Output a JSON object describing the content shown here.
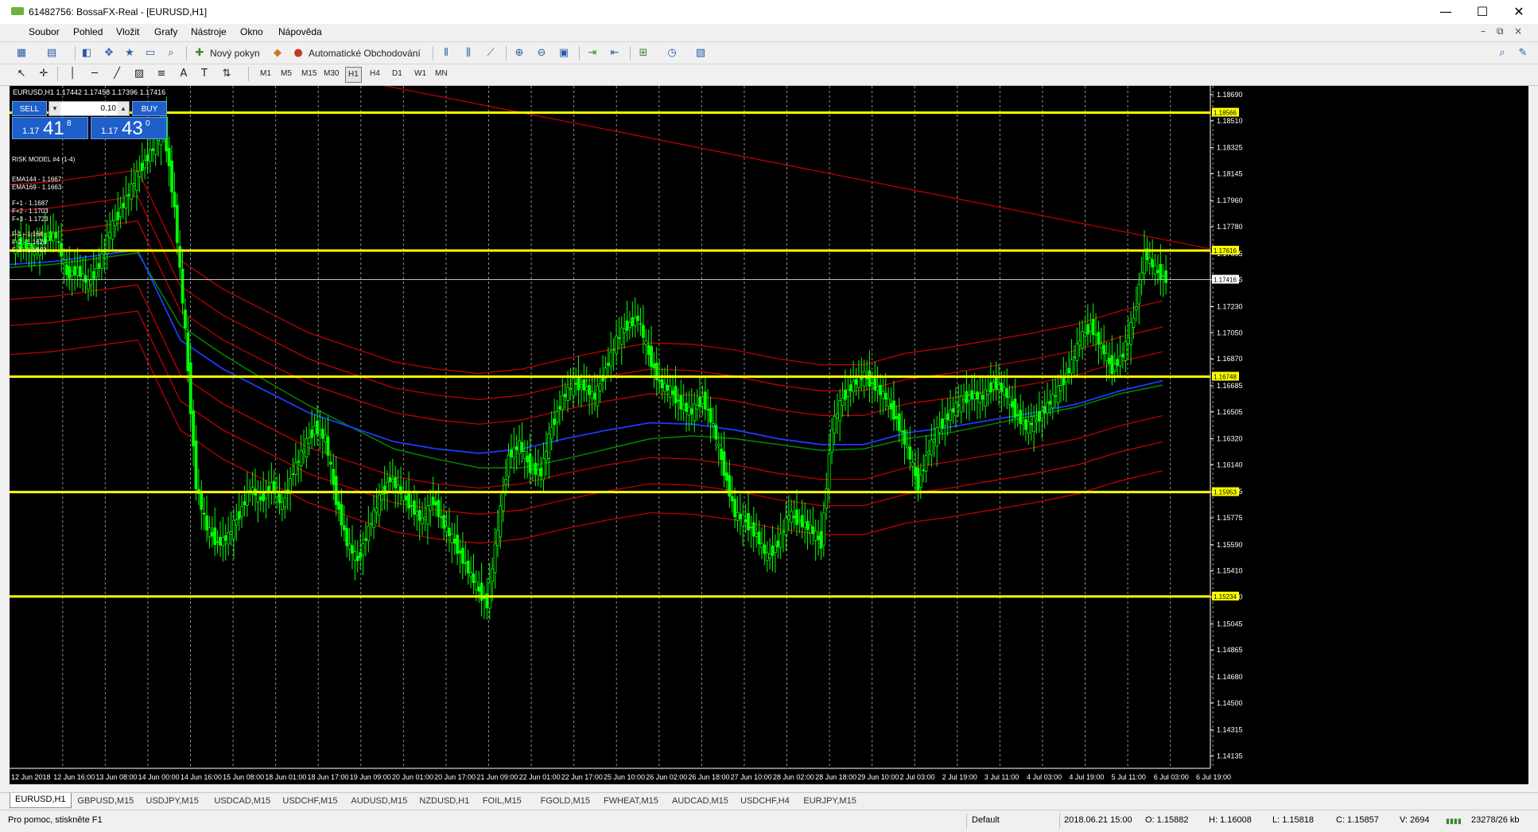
{
  "window": {
    "title": "61482756: BossaFX-Real - [EURUSD,H1]",
    "minimize": "—",
    "maximize": "☐",
    "close": "✕"
  },
  "menu": [
    "Soubor",
    "Pohled",
    "Vložit",
    "Grafy",
    "Nástroje",
    "Okno",
    "Nápověda"
  ],
  "toolbar": {
    "new_order": "Nový pokyn",
    "auto_trading": "Automatické Obchodování"
  },
  "timeframes": [
    "M1",
    "M5",
    "M15",
    "M30",
    "H1",
    "H4",
    "D1",
    "W1",
    "MN"
  ],
  "active_timeframe": "H1",
  "chart": {
    "header": "EURUSD,H1  1.17442 1.17458 1.17396 1.17416",
    "one_click": {
      "sell_label": "SELL",
      "buy_label": "BUY",
      "lot": "0.10",
      "sell_prefix": "1.17",
      "sell_big": "41",
      "sell_sup": "8",
      "buy_prefix": "1.17",
      "buy_big": "43",
      "buy_sup": "0"
    },
    "indicators": {
      "risk_model": "RISK MODEL #4 (1-4)",
      "ema144": "EMA144 - 1.1667",
      "ema169": "EMA169 - 1.1663",
      "fplus1": "F+1 - 1.1687",
      "fplus2": "F+2 - 1.1703",
      "fplus3": "F+3 - 1.1723",
      "fminus1": "F-1 - 1.164",
      "fminus2": "F-2 - 1.1623",
      "fminus3": "F-3 - 1.1603"
    },
    "colors": {
      "background": "#000000",
      "candle": "#00ff00",
      "level_line": "#ffff00",
      "envelope": "#cc0000",
      "ema144": "#1a3cff",
      "ema169": "#008800",
      "grid": "#ffffff"
    }
  },
  "chart_data": {
    "type": "candlestick",
    "symbol": "EURUSD",
    "timeframe": "H1",
    "y_ticks": [
      "1.18690",
      "1.18510",
      "1.18325",
      "1.18145",
      "1.17960",
      "1.17780",
      "1.17595",
      "1.17415",
      "1.17230",
      "1.17050",
      "1.16870",
      "1.16685",
      "1.16505",
      "1.16320",
      "1.16140",
      "1.15955",
      "1.15775",
      "1.15590",
      "1.15410",
      "1.15230",
      "1.15045",
      "1.14865",
      "1.14680",
      "1.14500",
      "1.14315",
      "1.14135"
    ],
    "x_ticks": [
      "12 Jun 2018",
      "12 Jun 16:00",
      "13 Jun 08:00",
      "14 Jun 00:00",
      "14 Jun 16:00",
      "15 Jun 08:00",
      "18 Jun 01:00",
      "18 Jun 17:00",
      "19 Jun 09:00",
      "20 Jun 01:00",
      "20 Jun 17:00",
      "21 Jun 09:00",
      "22 Jun 01:00",
      "22 Jun 17:00",
      "25 Jun 10:00",
      "26 Jun 02:00",
      "26 Jun 18:00",
      "27 Jun 10:00",
      "28 Jun 02:00",
      "28 Jun 18:00",
      "29 Jun 10:00",
      "2 Jul 03:00",
      "2 Jul 19:00",
      "3 Jul 11:00",
      "4 Jul 03:00",
      "4 Jul 19:00",
      "5 Jul 11:00",
      "6 Jul 03:00",
      "6 Jul 19:00"
    ],
    "y_range": [
      1.1405,
      1.1875
    ],
    "horizontal_levels": [
      {
        "value": 1.18566,
        "label": "1.18566"
      },
      {
        "value": 1.17616,
        "label": "1.17616"
      },
      {
        "value": 1.16748,
        "label": "1.16748"
      },
      {
        "value": 1.15953,
        "label": "1.15953"
      },
      {
        "value": 1.15234,
        "label": "1.15234"
      }
    ],
    "current_price": {
      "value": 1.17416,
      "label": "1.17416"
    },
    "closes": [
      1.1765,
      1.1762,
      1.177,
      1.1772,
      1.1745,
      1.1748,
      1.1738,
      1.1752,
      1.1775,
      1.179,
      1.1805,
      1.182,
      1.1832,
      1.1848,
      1.179,
      1.1705,
      1.16,
      1.157,
      1.156,
      1.1565,
      1.158,
      1.1598,
      1.159,
      1.16,
      1.1585,
      1.161,
      1.1625,
      1.164,
      1.1632,
      1.159,
      1.156,
      1.1548,
      1.157,
      1.159,
      1.1605,
      1.1595,
      1.1585,
      1.1575,
      1.159,
      1.1572,
      1.156,
      1.1545,
      1.153,
      1.1518,
      1.157,
      1.162,
      1.1628,
      1.1612,
      1.1608,
      1.164,
      1.166,
      1.167,
      1.1668,
      1.166,
      1.168,
      1.17,
      1.171,
      1.1715,
      1.169,
      1.167,
      1.1665,
      1.1655,
      1.165,
      1.166,
      1.164,
      1.161,
      1.158,
      1.1575,
      1.1565,
      1.155,
      1.156,
      1.158,
      1.1575,
      1.157,
      1.156,
      1.164,
      1.166,
      1.167,
      1.1675,
      1.1668,
      1.166,
      1.1645,
      1.1625,
      1.16,
      1.1625,
      1.164,
      1.165,
      1.1658,
      1.1662,
      1.166,
      1.167,
      1.1665,
      1.165,
      1.164,
      1.1645,
      1.1655,
      1.1665,
      1.168,
      1.17,
      1.171,
      1.1695,
      1.168,
      1.169,
      1.1715,
      1.176,
      1.1748,
      1.1742
    ],
    "ema144": [
      1.1752,
      1.1754,
      1.1758,
      1.1762,
      1.17,
      1.168,
      1.1665,
      1.165,
      1.164,
      1.163,
      1.1625,
      1.1622,
      1.1625,
      1.1632,
      1.1638,
      1.1643,
      1.1642,
      1.1638,
      1.1632,
      1.1628,
      1.1628,
      1.1636,
      1.164,
      1.1645,
      1.165,
      1.1656,
      1.1665,
      1.1672
    ],
    "ema169": [
      1.175,
      1.1752,
      1.1756,
      1.176,
      1.171,
      1.169,
      1.1672,
      1.1655,
      1.164,
      1.1625,
      1.1618,
      1.1612,
      1.1612,
      1.1618,
      1.1625,
      1.1632,
      1.1634,
      1.1632,
      1.1628,
      1.1624,
      1.1625,
      1.1632,
      1.1636,
      1.1642,
      1.1648,
      1.1654,
      1.1663,
      1.1669
    ],
    "trendline": {
      "from": [
        "12 Jun 2018",
        1.1895
      ],
      "to": [
        "6 Jul 19:00",
        1.1765
      ]
    }
  },
  "tabs": [
    "EURUSD,H1",
    "GBPUSD,M15",
    "USDJPY,M15",
    "USDCAD,M15",
    "USDCHF,M15",
    "AUDUSD,M15",
    "NZDUSD,H1",
    "FOIL,M15",
    "FGOLD,M15",
    "FWHEAT,M15",
    "AUDCAD,M15",
    "USDCHF,H4",
    "EURJPY,M15"
  ],
  "status": {
    "help": "Pro pomoc, stiskněte F1",
    "profile": "Default",
    "datetime": "2018.06.21 15:00",
    "open": "O: 1.15882",
    "high": "H: 1.16008",
    "low": "L: 1.15818",
    "close": "C: 1.15857",
    "volume": "V: 2694",
    "traffic": "23278/26 kb"
  }
}
